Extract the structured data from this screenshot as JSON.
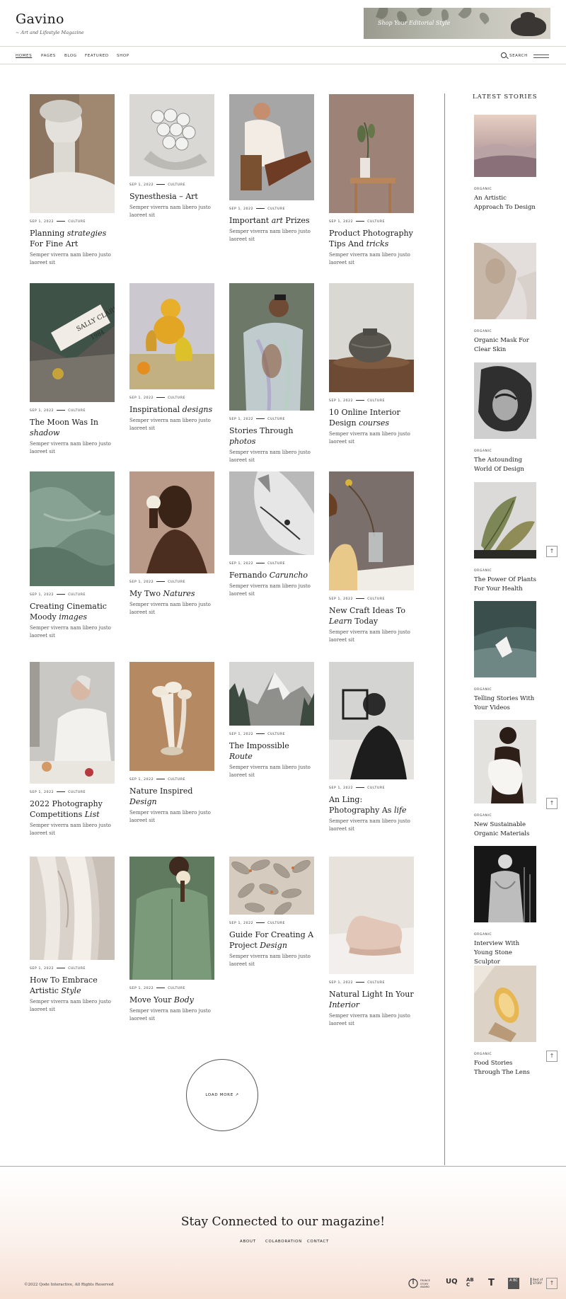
{
  "header": {
    "logo": "Gavino",
    "tagline": "~ Art and Lifestyle Magazine",
    "banner_text": "Shop Your Editorial Style"
  },
  "nav": {
    "items": [
      "HOMES",
      "PAGES",
      "BLOG",
      "FEATURED",
      "SHOP"
    ],
    "search_label": "SEARCH"
  },
  "posts": [
    {
      "date": "SEP 1, 2022",
      "category": "CULTURE",
      "title_parts": [
        "Planning ",
        "strategies",
        " For Fine Art"
      ],
      "excerpt": "Semper viverra nam libero justo laoreet sit"
    },
    {
      "date": "SEP 1, 2022",
      "category": "CULTURE",
      "title_parts": [
        "Synesthesia – Art",
        "",
        ""
      ],
      "excerpt": "Semper viverra nam libero justo laoreet sit"
    },
    {
      "date": "SEP 1, 2022",
      "category": "CULTURE",
      "title_parts": [
        "Important ",
        "art",
        " Prizes"
      ],
      "excerpt": "Semper viverra nam libero justo laoreet sit"
    },
    {
      "date": "SEP 1, 2022",
      "category": "CULTURE",
      "title_parts": [
        "Product Photography Tips And ",
        "tricks",
        ""
      ],
      "excerpt": "Semper viverra nam libero justo laoreet sit"
    },
    {
      "date": "SEP 1, 2022",
      "category": "CULTURE",
      "title_parts": [
        "The Moon Was In ",
        "shadow",
        ""
      ],
      "excerpt": "Semper viverra nam libero justo laoreet sit"
    },
    {
      "date": "SEP 1, 2022",
      "category": "CULTURE",
      "title_parts": [
        "Inspirational ",
        "designs",
        ""
      ],
      "excerpt": "Semper viverra nam libero justo laoreet sit"
    },
    {
      "date": "SEP 1, 2022",
      "category": "CULTURE",
      "title_parts": [
        "Stories Through ",
        "photos",
        ""
      ],
      "excerpt": "Semper viverra nam libero justo laoreet sit"
    },
    {
      "date": "SEP 1, 2022",
      "category": "CULTURE",
      "title_parts": [
        "10 Online Interior Design ",
        "courses",
        ""
      ],
      "excerpt": "Semper viverra nam libero justo laoreet sit"
    },
    {
      "date": "SEP 1, 2022",
      "category": "CULTURE",
      "title_parts": [
        "Creating Cinematic Moody ",
        "images",
        ""
      ],
      "excerpt": "Semper viverra nam libero justo laoreet sit"
    },
    {
      "date": "SEP 1, 2022",
      "category": "CULTURE",
      "title_parts": [
        "My Two ",
        "Natures",
        ""
      ],
      "excerpt": "Semper viverra nam libero justo laoreet sit"
    },
    {
      "date": "SEP 1, 2022",
      "category": "CULTURE",
      "title_parts": [
        "Fernando ",
        "Caruncho",
        ""
      ],
      "excerpt": "Semper viverra nam libero justo laoreet sit"
    },
    {
      "date": "SEP 1, 2022",
      "category": "CULTURE",
      "title_parts": [
        "New Craft Ideas To ",
        "Learn",
        " Today"
      ],
      "excerpt": "Semper viverra nam libero justo laoreet sit"
    },
    {
      "date": "SEP 1, 2022",
      "category": "CULTURE",
      "title_parts": [
        "2022 Photography Competitions ",
        "List",
        ""
      ],
      "excerpt": "Semper viverra nam libero justo laoreet sit"
    },
    {
      "date": "SEP 1, 2022",
      "category": "CULTURE",
      "title_parts": [
        "Nature Inspired ",
        "Design",
        ""
      ],
      "excerpt": "Semper viverra nam libero justo laoreet sit"
    },
    {
      "date": "SEP 1, 2022",
      "category": "CULTURE",
      "title_parts": [
        "The Impossible ",
        "Route",
        ""
      ],
      "excerpt": "Semper viverra nam libero justo laoreet sit"
    },
    {
      "date": "SEP 1, 2022",
      "category": "CULTURE",
      "title_parts": [
        "An Ling: Photography As ",
        "life",
        ""
      ],
      "excerpt": "Semper viverra nam libero justo laoreet sit"
    },
    {
      "date": "SEP 1, 2022",
      "category": "CULTURE",
      "title_parts": [
        "How To Embrace Artistic ",
        "Style",
        ""
      ],
      "excerpt": "Semper viverra nam libero justo laoreet sit"
    },
    {
      "date": "SEP 1, 2022",
      "category": "CULTURE",
      "title_parts": [
        "Move Your ",
        "Body",
        ""
      ],
      "excerpt": "Semper viverra nam libero justo laoreet sit"
    },
    {
      "date": "SEP 1, 2022",
      "category": "CULTURE",
      "title_parts": [
        "Guide For Creating A Project ",
        "Design",
        ""
      ],
      "excerpt": "Semper viverra nam libero justo laoreet sit"
    },
    {
      "date": "SEP 1, 2022",
      "category": "CULTURE",
      "title_parts": [
        "Natural Light In Your ",
        "Interior",
        ""
      ],
      "excerpt": "Semper viverra nam libero justo laoreet sit"
    }
  ],
  "sidebar": {
    "title": "LATEST STORIES",
    "items": [
      {
        "tag": "ORGANIC",
        "title": "An Artistic Approach To Design"
      },
      {
        "tag": "ORGANIC",
        "title": "Organic Mask For Clear Skin"
      },
      {
        "tag": "ORGANIC",
        "title": "The Astounding World Of Design"
      },
      {
        "tag": "ORGANIC",
        "title": "The Power Of Plants For Your Health"
      },
      {
        "tag": "ORGANIC",
        "title": "Telling Stories With Your Videos"
      },
      {
        "tag": "ORGANIC",
        "title": "New Sustainable Organic Materials"
      },
      {
        "tag": "ORGANIC",
        "title": "Interview With Young Stone Sculptor"
      },
      {
        "tag": "ORGANIC",
        "title": "Food Stories Through The Lens"
      }
    ]
  },
  "load_more_label": "LOAD MORE ↗",
  "back_to_top": "↑",
  "footer": {
    "title": "Stay Connected to our magazine!",
    "links": [
      "ABOUT",
      "COLABORATION",
      "CONTACT"
    ],
    "copyright": "©2022 Qode Interactive, All Rights Reserved",
    "awards": [
      "FRANCE STORY AWARD",
      "UQ",
      "ABC",
      "T",
      "A BC",
      "Best of STORY"
    ]
  },
  "colors": {
    "accent": "#1b1b1b",
    "footer_gradient_end": "#f6dfd3"
  }
}
